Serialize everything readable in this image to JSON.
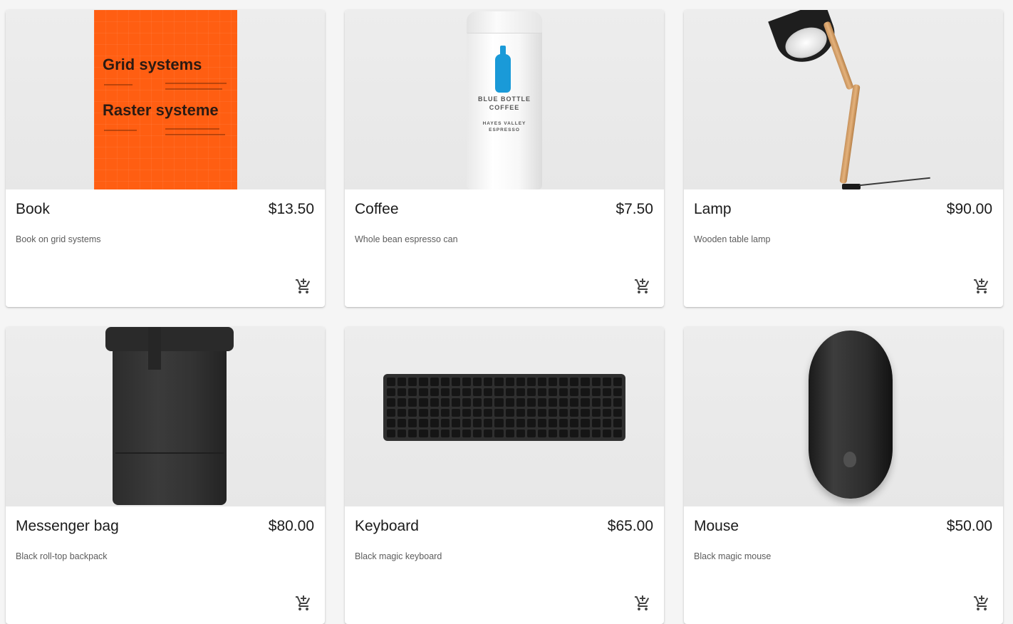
{
  "products": [
    {
      "title": "Book",
      "price": "$13.50",
      "description": "Book on grid systems",
      "image": "book-cover-image"
    },
    {
      "title": "Coffee",
      "price": "$7.50",
      "description": "Whole bean espresso can",
      "image": "coffee-can-image"
    },
    {
      "title": "Lamp",
      "price": "$90.00",
      "description": "Wooden table lamp",
      "image": "desk-lamp-image"
    },
    {
      "title": "Messenger bag",
      "price": "$80.00",
      "description": "Black roll-top backpack",
      "image": "backpack-image"
    },
    {
      "title": "Keyboard",
      "price": "$65.00",
      "description": "Black magic keyboard",
      "image": "keyboard-image"
    },
    {
      "title": "Mouse",
      "price": "$50.00",
      "description": "Black magic mouse",
      "image": "mouse-image"
    }
  ],
  "product_art": {
    "book_cover": {
      "line1": "Grid systems",
      "line2": "Raster systeme"
    },
    "coffee_label": {
      "brand_line1": "BLUE BOTTLE",
      "brand_line2": "COFFEE",
      "blend_line1": "HAYES VALLEY",
      "blend_line2": "ESPRESSO"
    }
  },
  "icons": {
    "add_to_cart": "add-shopping-cart-icon"
  }
}
